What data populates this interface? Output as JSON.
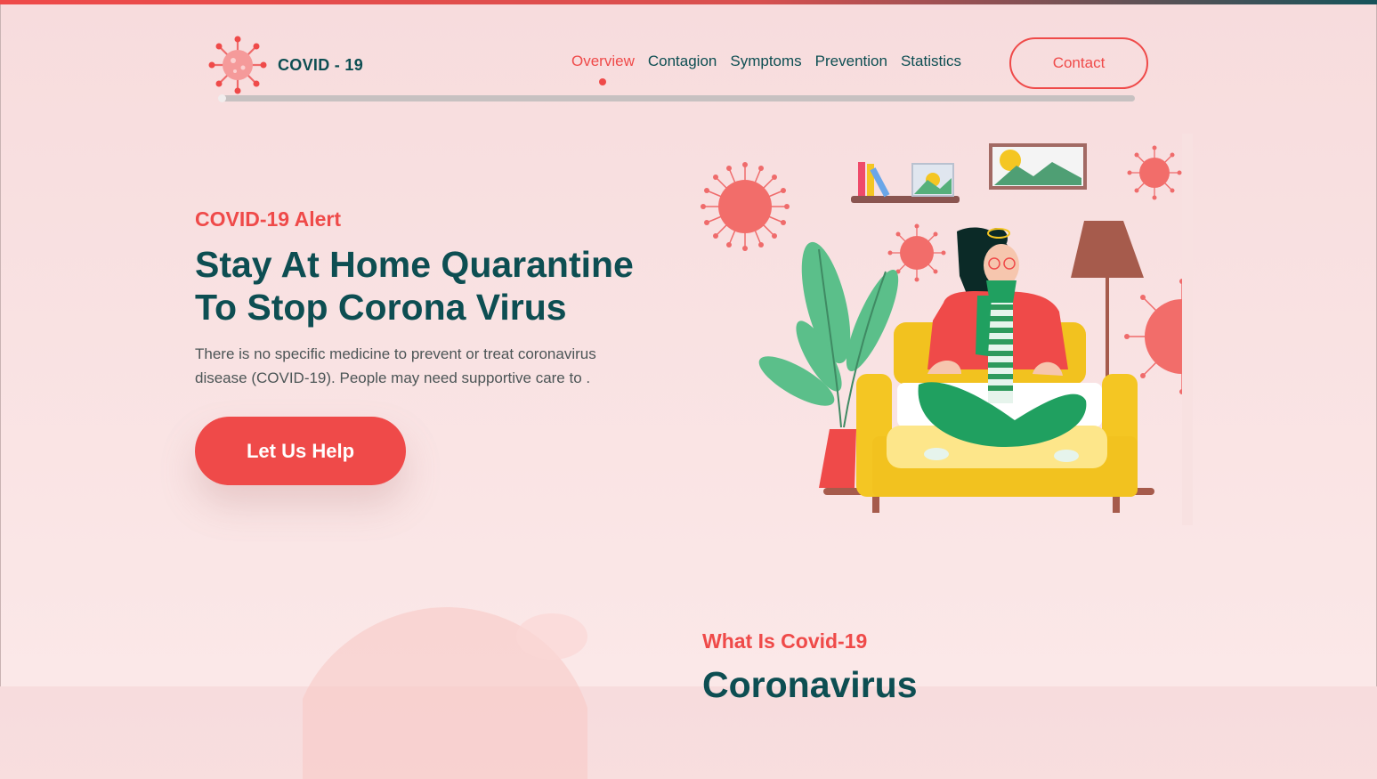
{
  "brand": {
    "name": "COVID - 19",
    "logo_icon": "virus-icon"
  },
  "nav": {
    "items": [
      {
        "label": "Overview",
        "active": true
      },
      {
        "label": "Contagion",
        "active": false
      },
      {
        "label": "Symptoms",
        "active": false
      },
      {
        "label": "Prevention",
        "active": false
      },
      {
        "label": "Statistics",
        "active": false
      }
    ],
    "contact_label": "Contact"
  },
  "hero": {
    "kicker": "COVID-19 Alert",
    "title": "Stay At Home Quarantine To Stop Corona Virus",
    "description": "There is no specific medicine to prevent or treat coronavirus disease (COVID-19). People may need supportive care to .",
    "cta_label": "Let Us Help",
    "illustration": "woman-on-sofa-quarantine-illustration"
  },
  "section": {
    "kicker": "What Is Covid-19",
    "title": "Coronavirus"
  },
  "colors": {
    "accent": "#ef4a49",
    "primary": "#0d4e52",
    "background": "#f7dcdd"
  }
}
